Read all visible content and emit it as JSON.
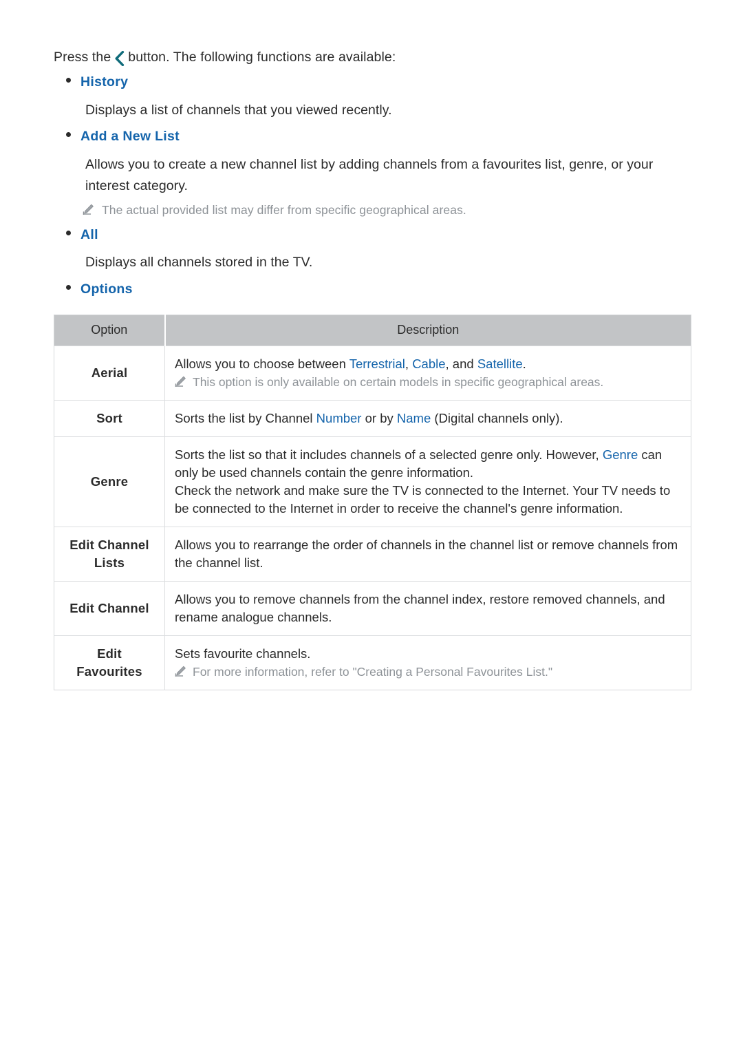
{
  "colors": {
    "link_blue": "#1464ab",
    "chevron_teal": "#0f6b7a",
    "note_gray": "#8d9297",
    "table_header_bg": "#c2c4c6",
    "body_text": "#2b2b2b"
  },
  "intro": {
    "before_icon": "Press the",
    "icon": "chevron-left-icon",
    "after_icon": "button. The following functions are available:"
  },
  "sections": [
    {
      "id": "history",
      "label": "History",
      "body": "Displays a list of channels that you viewed recently."
    },
    {
      "id": "add-a-new-list",
      "label": "Add a New List",
      "body_line1": "Allows you to create a new channel list by adding channels from a favourites list, genre, or your",
      "body_line2": "interest category.",
      "note": "The actual provided list may differ from specific geographical areas."
    },
    {
      "id": "all",
      "label": "All",
      "body": "Displays all channels stored in the TV."
    },
    {
      "id": "options",
      "label": "Options"
    }
  ],
  "table": {
    "headers": [
      "Option",
      "Description"
    ],
    "rows": [
      {
        "option": "Aerial",
        "desc_pre": "Allows you to choose between ",
        "kw1": "Terrestrial",
        "desc_mid1": ", ",
        "kw2": "Cable",
        "desc_mid2": ", and ",
        "kw3": "Satellite",
        "desc_post": ".",
        "note": "This option is only available on certain models in specific geographical areas."
      },
      {
        "option": "Sort",
        "desc_pre": "Sorts the list by Channel ",
        "kw1": "Number",
        "desc_mid1": " or by ",
        "kw2": "Name",
        "desc_post": " (Digital channels only)."
      },
      {
        "option": "Genre",
        "p1_pre": "Sorts the list so that it includes channels of a selected genre only. However, ",
        "p1_kw": "Genre",
        "p1_post": " can",
        "p1_line2": "only be used channels contain the genre information.",
        "p2_line1": "Check the network and make sure the TV is connected to the Internet. Your TV needs to",
        "p2_line2": "be connected to the Internet in order to receive the channel's genre information."
      },
      {
        "option_line1": "Edit Channel",
        "option_line2": "Lists",
        "desc_line1": "Allows you to rearrange the order of channels in the channel list or remove channels from",
        "desc_line2": "the channel list."
      },
      {
        "option": "Edit Channel",
        "desc_line1": "Allows you to remove channels from the channel index, restore removed channels, and",
        "desc_line2": "rename analogue channels."
      },
      {
        "option": "Edit Favourites",
        "desc_line1": "Sets favourite channels.",
        "note": "For more information, refer to \"Creating a Personal Favourites List.\""
      }
    ]
  }
}
